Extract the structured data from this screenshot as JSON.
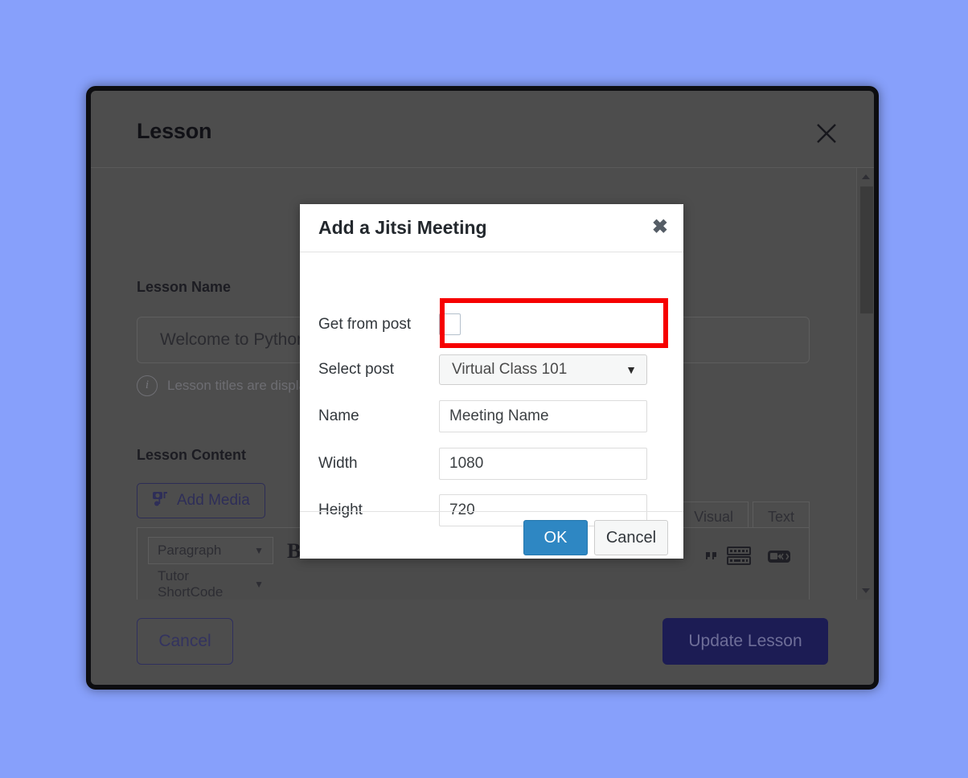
{
  "page": {
    "background_color": "#87a0fb"
  },
  "lesson_modal": {
    "title": "Lesson",
    "close_icon": "close-icon",
    "lesson_name_label": "Lesson Name",
    "lesson_name_value": "Welcome to Python Programming",
    "hint_icon": "info-icon",
    "hint_text": "Lesson titles are displayed publicly wherever required.",
    "lesson_content_label": "Lesson Content",
    "add_media_label": "Add Media",
    "add_media_icon": "media-icon",
    "toolbar": {
      "paragraph_select": "Paragraph",
      "shortcode_select": "Tutor ShortCode",
      "bold_label": "B",
      "icons": [
        "quote-icon",
        "keyboard-icon",
        "video-code-icon"
      ]
    },
    "editor_tabs": [
      "Visual",
      "Text"
    ],
    "scrollbar": {
      "up_icon": "chevron-up-icon",
      "down_icon": "chevron-down-icon"
    },
    "cancel_label": "Cancel",
    "update_label": "Update Lesson"
  },
  "jitsi_dialog": {
    "title": "Add a Jitsi Meeting",
    "close_icon": "close-icon",
    "rows": [
      {
        "label": "Get from post",
        "type": "checkbox",
        "checked": false
      },
      {
        "label": "Select post",
        "type": "select",
        "value": "Virtual Class 101",
        "caret": "caret-down-icon"
      },
      {
        "label": "Name",
        "type": "text",
        "value": "Meeting Name"
      },
      {
        "label": "Width",
        "type": "text",
        "value": "1080"
      },
      {
        "label": "Height",
        "type": "text",
        "value": "720"
      }
    ],
    "ok_label": "OK",
    "cancel_label": "Cancel"
  },
  "annotation": {
    "highlight_color": "#f60000",
    "target": "Select post"
  }
}
